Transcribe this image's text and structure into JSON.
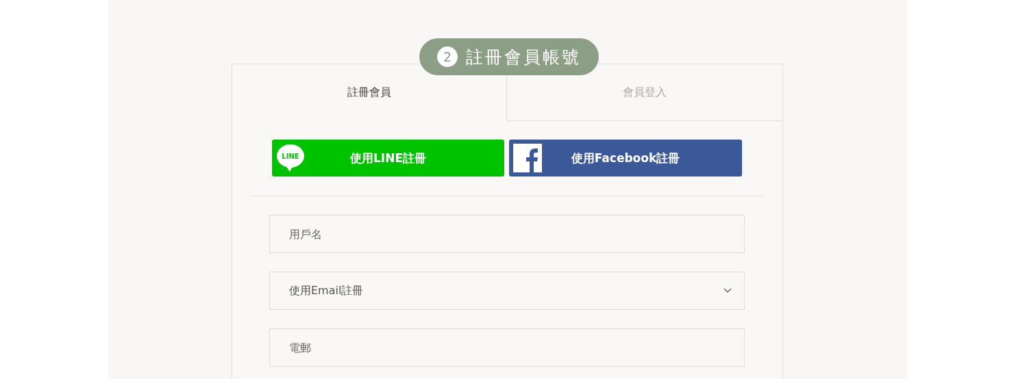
{
  "badge": {
    "number": "2",
    "title": "註冊會員帳號"
  },
  "tabs": [
    {
      "label": "註冊會員",
      "selected": true
    },
    {
      "label": "會員登入",
      "selected": false
    }
  ],
  "social_buttons": [
    {
      "kind": "line",
      "icon_text": "LINE",
      "label": "使用LINE註冊"
    },
    {
      "kind": "facebook",
      "label": "使用Facebook註冊"
    }
  ],
  "fields": [
    {
      "kind": "input",
      "placeholder": "用戶名"
    },
    {
      "kind": "select",
      "value": "使用Email註冊"
    },
    {
      "kind": "input",
      "placeholder": "電郵"
    }
  ]
}
